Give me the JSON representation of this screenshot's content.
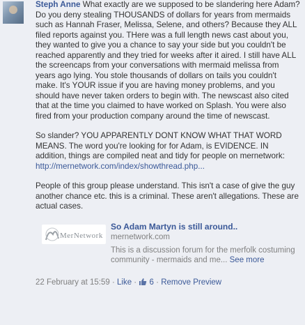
{
  "comment": {
    "author": "Steph Anne",
    "intro": "What exactly are we supposed to be slandering here Adam? Do you deny stealing THOUSANDS of dollars for years from mermaids such as Hannah Fraser, Melissa, Selene, and others? Because they ALL filed reports against you. THere was a full length news cast about you, they wanted to give you a chance to say your side but you couldn't be reached apparently and they tried for weeks after it aired. I still have ALL the screencaps from your conversations with mermaid melissa from years ago lying. You stole thousands of dollars on tails you couldn't make. It's YOUR issue if you are having money problems, and you should have never taken orders to begin with. The newscast also cited that at the time you claimed to have worked on Splash. You were also fired from your production company around the time of newscast.",
    "paragraph2": "So slander? YOU APPARENTLY DONT KNOW WHAT THAT WORD MEANS. The word you're looking for for Adam, is EVIDENCE. IN addition, things are compiled neat and tidy for people on mernetwork:",
    "link_url": "http://mernetwork.com/index/showthread.php...",
    "paragraph3": "People of this group please understand. This isn't a case of give the guy another chance etc. this is a criminal. These aren't allegations. These are actual cases."
  },
  "preview": {
    "logo_text": "MerNetwork",
    "title": "So Adam Martyn is still around..",
    "domain": "mernetwork.com",
    "description": "This is a discussion forum for the merfolk costuming community - mermaids and me...",
    "see_more": "See more"
  },
  "footer": {
    "timestamp": "22 February at 15:59",
    "sep1": " · ",
    "like": "Like",
    "sep2": " · ",
    "like_count": "6",
    "sep3": " · ",
    "remove_preview": "Remove Preview"
  },
  "colors": {
    "link": "#3b5998",
    "text": "#333333",
    "muted": "#808080",
    "background": "#edeff4"
  }
}
